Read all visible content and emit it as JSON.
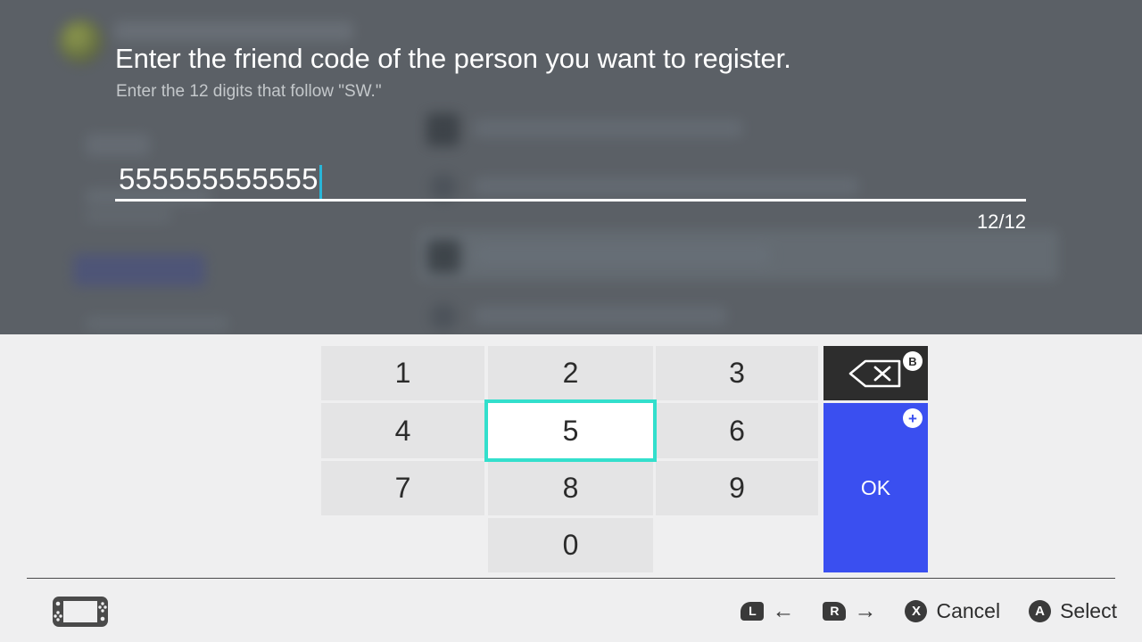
{
  "prompt": {
    "title": "Enter the friend code of the person you want to register.",
    "subtitle": "Enter the 12 digits that follow \"SW.\"",
    "field_value": "555555555555",
    "char_counter": "12/12"
  },
  "keypad": {
    "keys": [
      {
        "label": "1",
        "selected": false
      },
      {
        "label": "2",
        "selected": false
      },
      {
        "label": "3",
        "selected": false
      },
      {
        "label": "4",
        "selected": false
      },
      {
        "label": "5",
        "selected": true
      },
      {
        "label": "6",
        "selected": false
      },
      {
        "label": "7",
        "selected": false
      },
      {
        "label": "8",
        "selected": false
      },
      {
        "label": "9",
        "selected": false
      },
      {
        "label": "0",
        "selected": false
      }
    ],
    "backspace": {
      "icon": "backspace-icon",
      "badge": "B"
    },
    "ok": {
      "label": "OK",
      "badge": "+"
    }
  },
  "hints": [
    {
      "button": "L",
      "label": "",
      "icon": "arrow-left-icon",
      "glyph": "←"
    },
    {
      "button": "R",
      "label": "",
      "icon": "arrow-right-icon",
      "glyph": "→"
    },
    {
      "button": "X",
      "label": "Cancel",
      "icon": "",
      "glyph": ""
    },
    {
      "button": "A",
      "label": "Select",
      "icon": "",
      "glyph": ""
    }
  ],
  "status_bar": {
    "console_icon": "switch-console-icon"
  },
  "colors": {
    "backdrop": "#5b6066",
    "panel": "#efeff0",
    "key": "#e4e4e5",
    "selection": "#33dfcc",
    "ok_blue": "#3a4ff0",
    "backspace_dark": "#2d2d2d",
    "caret": "#29b6d8"
  }
}
